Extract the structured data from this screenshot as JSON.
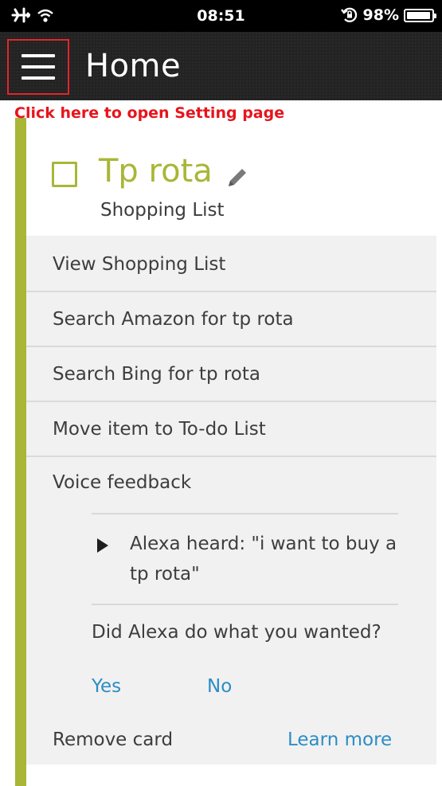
{
  "status_bar": {
    "time": "08:51",
    "battery_text": "98%",
    "battery_level": 0.98,
    "icons": [
      "airplane-icon",
      "wifi-icon",
      "rotation-lock-icon",
      "battery-icon"
    ]
  },
  "header": {
    "title": "Home",
    "menu_icon": "hamburger-menu-icon"
  },
  "annotation": {
    "text": "Click here to open Setting page",
    "color": "#e8141c"
  },
  "card": {
    "accent_color": "#a9b637",
    "item_title": "Tp rota",
    "list_name": "Shopping List",
    "edit_icon": "pencil-icon",
    "actions": [
      "View Shopping List",
      "Search Amazon for tp rota",
      "Search Bing for tp rota",
      "Move item to To-do List"
    ],
    "voice_feedback": {
      "label": "Voice feedback",
      "heard": "Alexa heard: \"i want to buy a tp rota\"",
      "question": "Did Alexa do what you wanted?",
      "yes": "Yes",
      "no": "No"
    },
    "remove_card": "Remove card",
    "learn_more": "Learn more",
    "link_color": "#2c8dc4"
  }
}
